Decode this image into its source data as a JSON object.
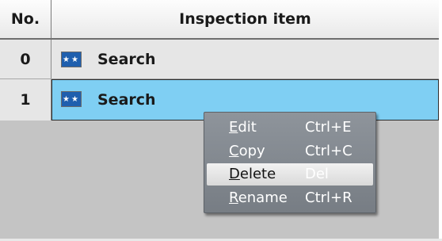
{
  "table": {
    "headers": {
      "no": "No.",
      "item": "Inspection item"
    },
    "rows": [
      {
        "no": "0",
        "item": "Search",
        "icon": "processing-unit-icon"
      },
      {
        "no": "1",
        "item": "Search",
        "icon": "processing-unit-icon"
      }
    ]
  },
  "context_menu": {
    "items": [
      {
        "accel": "E",
        "rest": "dit",
        "shortcut": "Ctrl+E"
      },
      {
        "accel": "C",
        "rest": "opy",
        "shortcut": "Ctrl+C"
      },
      {
        "accel": "D",
        "rest": "elete",
        "shortcut": "Del",
        "highlighted": true
      },
      {
        "accel": "R",
        "rest": "ename",
        "shortcut": "Ctrl+R"
      }
    ]
  },
  "colors": {
    "selection": "#7fcff3",
    "menu_background": "#8e949b",
    "icon_background": "#1f5fae"
  }
}
